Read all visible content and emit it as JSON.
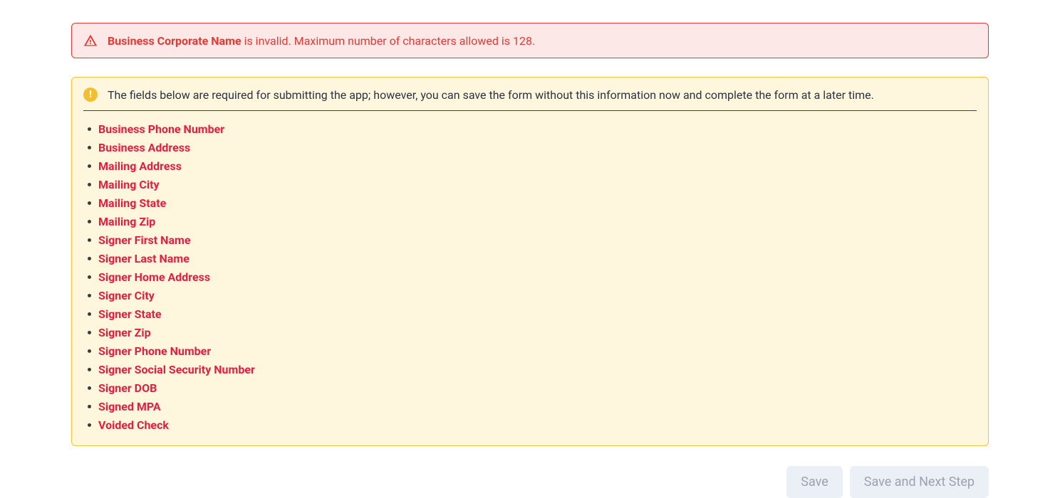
{
  "errorAlert": {
    "fieldName": "Business Corporate Name",
    "message": " is invalid. Maximum number of characters allowed is 128."
  },
  "warningAlert": {
    "message": "The fields below are required for submitting the app; however, you can save the form without this information now and complete the form at a later time.",
    "requiredFields": [
      "Business Phone Number",
      "Business Address",
      "Mailing Address",
      "Mailing City",
      "Mailing State",
      "Mailing Zip",
      "Signer First Name",
      "Signer Last Name",
      "Signer Home Address",
      "Signer City",
      "Signer State",
      "Signer Zip",
      "Signer Phone Number",
      "Signer Social Security Number",
      "Signer DOB",
      "Signed MPA",
      "Voided Check"
    ]
  },
  "buttons": {
    "save": "Save",
    "saveAndNext": "Save and Next Step"
  }
}
